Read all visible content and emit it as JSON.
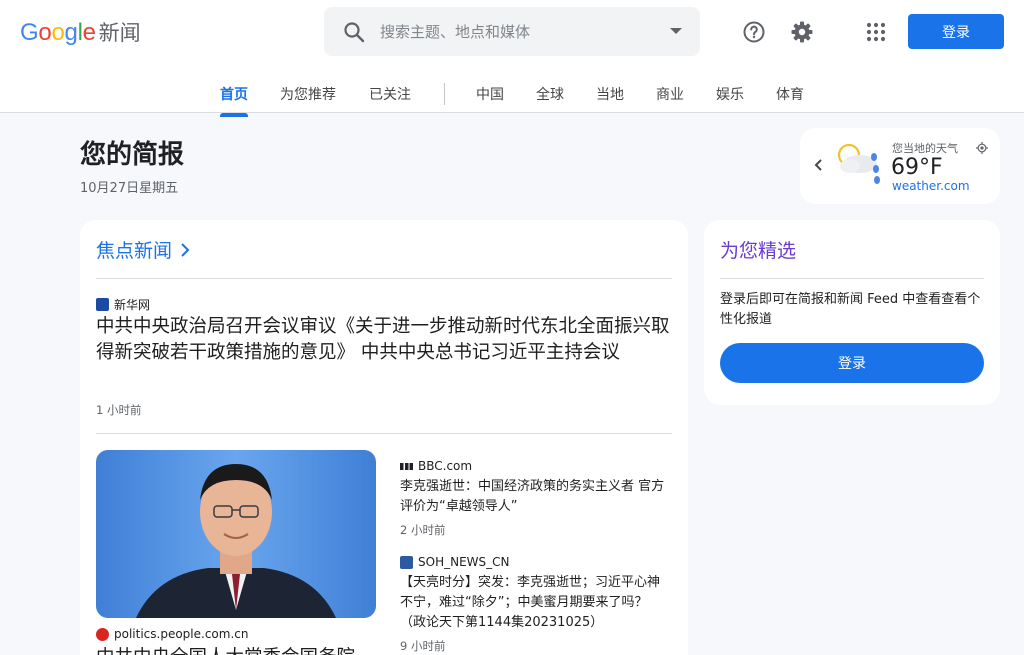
{
  "header": {
    "logo_letters": [
      "G",
      "o",
      "o",
      "g",
      "l",
      "e"
    ],
    "logo_suffix": "新闻",
    "search_placeholder": "搜索主题、地点和媒体",
    "login_label": "登录"
  },
  "nav": {
    "tabs": [
      "首页",
      "为您推荐",
      "已关注",
      "中国",
      "全球",
      "当地",
      "商业",
      "娱乐",
      "体育"
    ],
    "active_index": 0
  },
  "briefing": {
    "title": "您的简报",
    "date": "10月27日星期五"
  },
  "weather": {
    "label": "您当地的天气",
    "temp": "69°F",
    "source": "weather.com",
    "icon": "partly-cloudy-rain-icon"
  },
  "top_stories": {
    "title": "焦点新闻",
    "lead": {
      "source": "新华网",
      "headline": "中共中央政治局召开会议审议《关于进一步推动新时代东北全面振兴取得新突破若干政策措施的意见》 中共中央总书记习近平主持会议",
      "time": "1 小时前"
    },
    "photo_caption_source": "politics.people.com.cn",
    "photo_caption_headline": "中共中央全国人大常委会国务院",
    "side_items": [
      {
        "source": "BBC.com",
        "headline": "李克强逝世：中国经济政策的务实主义者 官方评价为“卓越领导人”",
        "time": "2 小时前"
      },
      {
        "source": "SOH_NEWS_CN",
        "headline": "【天亮时分】突发：李克强逝世；习近平心神不宁，难过“除夕”；中美蜜月期要来了吗？（政论天下第1144集20231025）",
        "time": "9 小时前"
      }
    ]
  },
  "for_you": {
    "title": "为您精选",
    "text": "登录后即可在简报和新闻 Feed 中查看查看个性化报道",
    "button": "登录"
  },
  "colors": {
    "accent": "#1a73e8",
    "for_you_title": "#6c3bd0",
    "logo": [
      "#4285f4",
      "#ea4335",
      "#fbbc05",
      "#4285f4",
      "#34a853",
      "#ea4335"
    ]
  }
}
